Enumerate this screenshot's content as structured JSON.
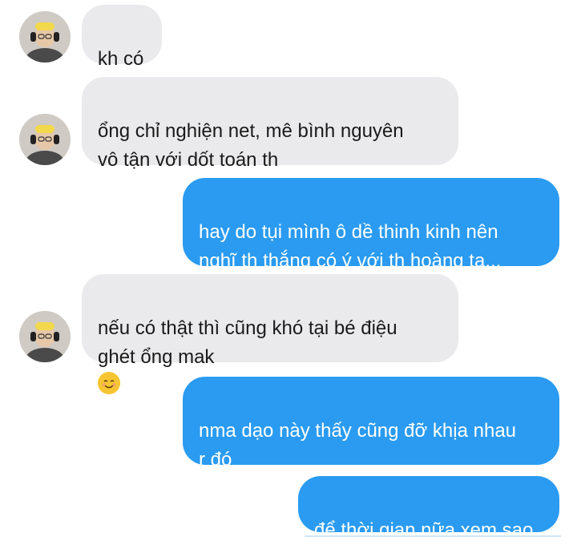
{
  "messages": [
    {
      "side": "in",
      "text": "kh có"
    },
    {
      "side": "in",
      "text": "ổng chỉ nghiện net, mê bình nguyên\nvô tận với dốt toán th"
    },
    {
      "side": "out",
      "text": "hay do tụi mình ô dề thinh kinh nên\nnghĩ th thắng có ý với th hoàng ta..."
    },
    {
      "side": "in",
      "text": "nếu có thật thì cũng khó tại bé điệu\nghét ổng mak",
      "emoji": "smiling-face-icon"
    },
    {
      "side": "out",
      "text": "nma dạo này thấy cũng đỡ khịa nhau\nr đó"
    },
    {
      "side": "out",
      "text": "để thời gian nữa xem sao"
    }
  ],
  "colors": {
    "incoming_bubble": "#eaeaec",
    "outgoing_bubble": "#2a9bf0",
    "incoming_text": "#1a1a1a",
    "outgoing_text": "#ffffff"
  }
}
